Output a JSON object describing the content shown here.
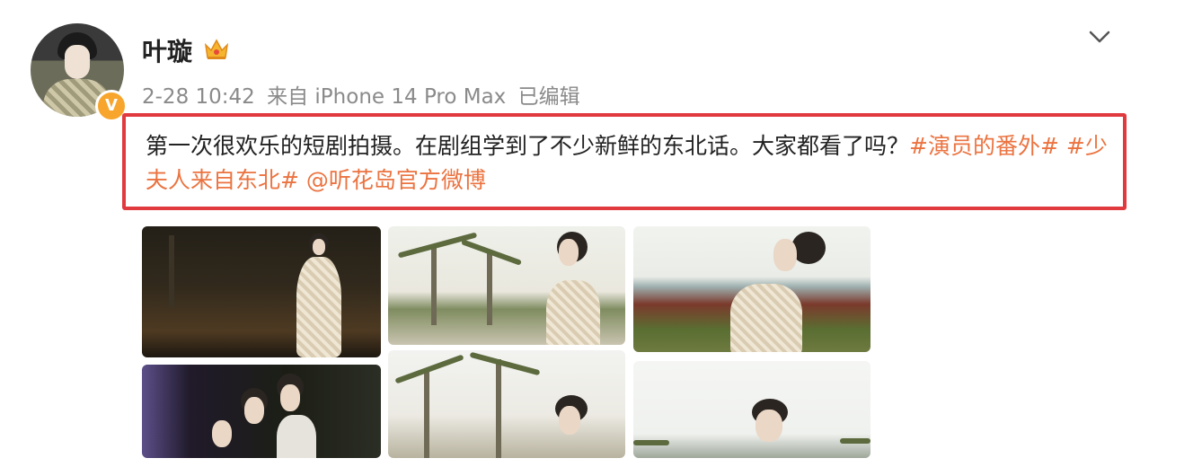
{
  "user": {
    "name": "叶璇",
    "badge_icon": "crown-icon",
    "verified_icon": "verified-v-icon",
    "verified_glyph": "V"
  },
  "meta": {
    "date": "2-28 10:42",
    "source": "来自 iPhone 14 Pro Max",
    "edited": "已编辑"
  },
  "post": {
    "text": "第一次很欢乐的短剧拍摄。在剧组学到了不少新鲜的东北话。大家都看了吗？",
    "topics": [
      "#演员的番外#",
      "#少夫人来自东北#"
    ],
    "mention": "@听花岛官方微博"
  },
  "menu": {
    "chevron_icon": "chevron-down-icon"
  },
  "colors": {
    "link": "#eb7340",
    "highlight_border": "#e0393e",
    "meta_text": "#8a8a8a",
    "verified": "#f7a52c"
  }
}
